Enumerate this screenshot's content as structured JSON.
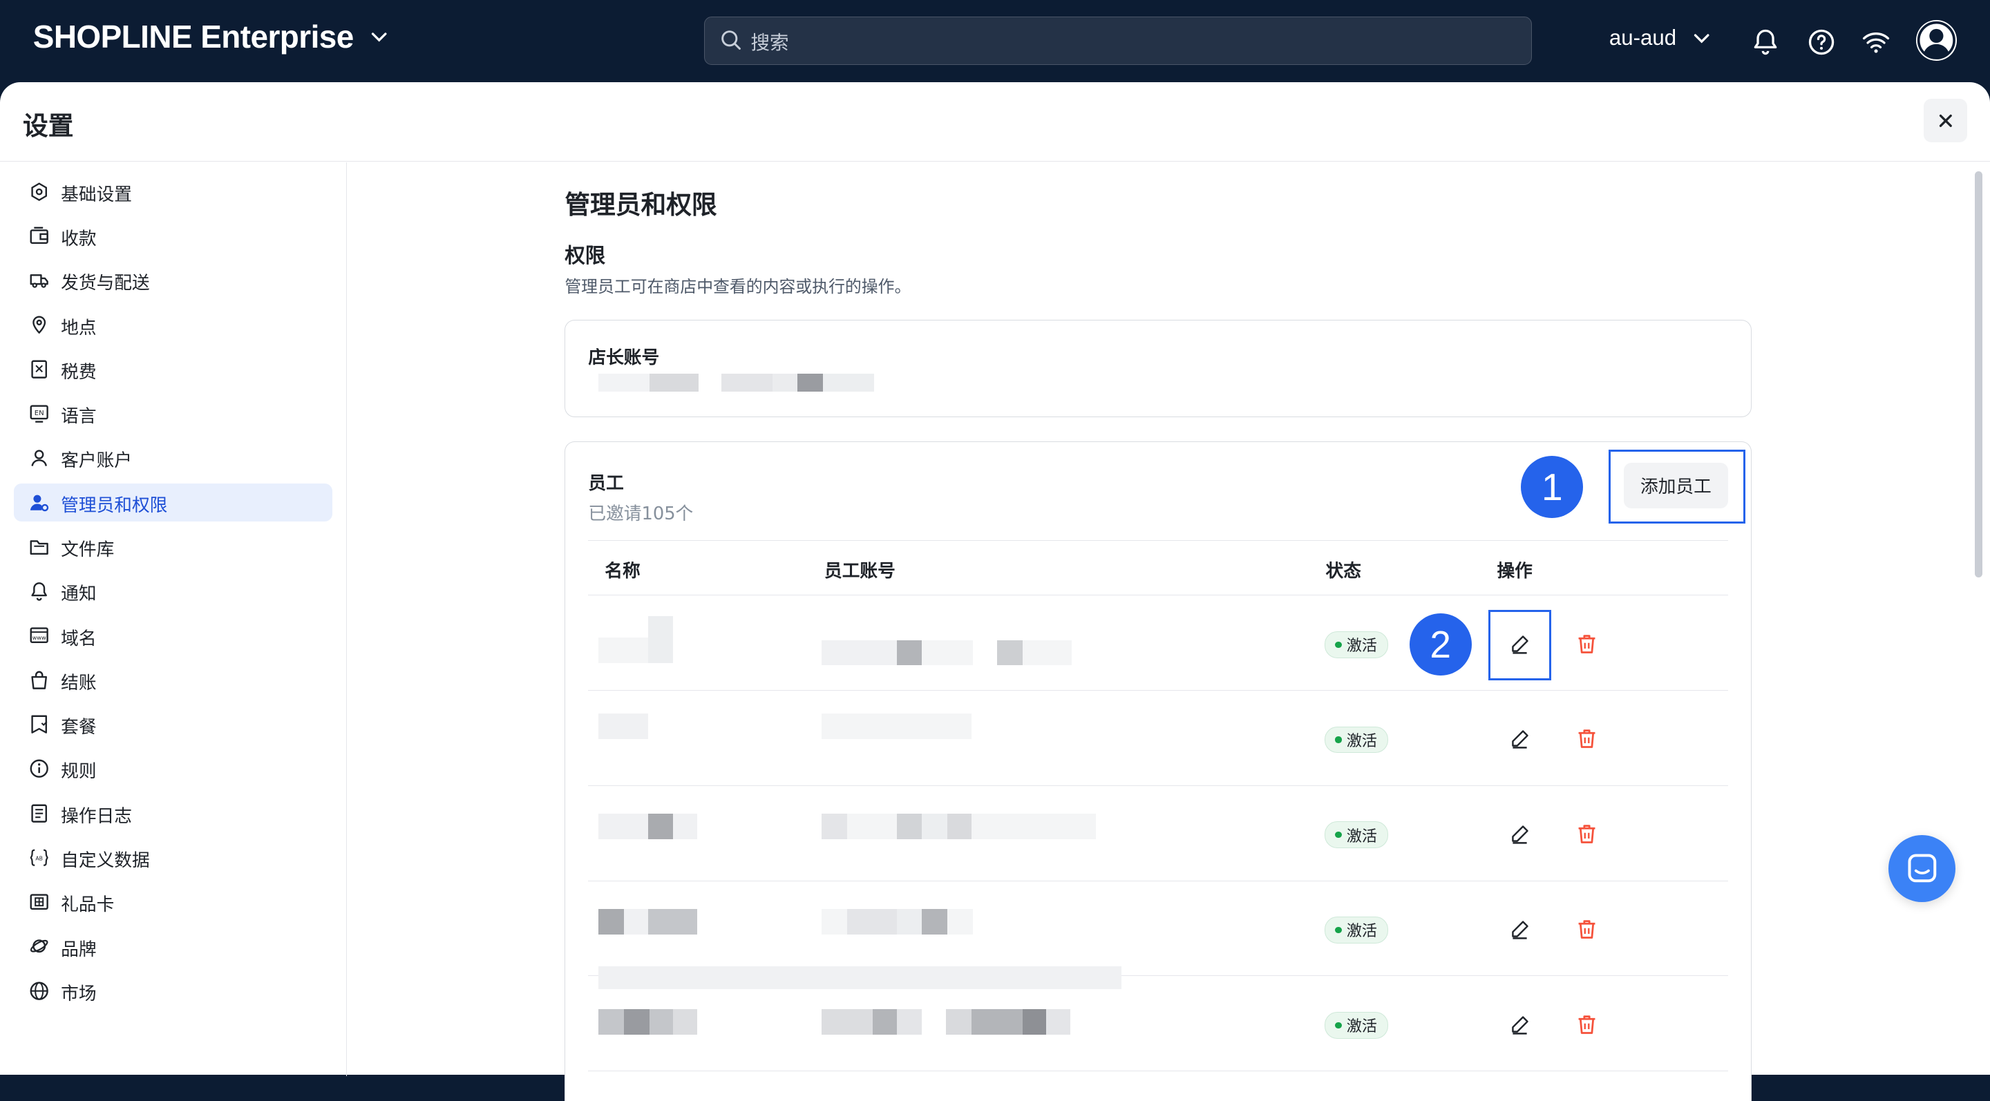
{
  "app": {
    "brand": "SHOPLINE Enterprise",
    "search_placeholder": "搜索",
    "store_name": "au-aud"
  },
  "panel": {
    "title": "设置"
  },
  "sidebar": {
    "items": [
      {
        "label": "基础设置",
        "icon": "store-settings-icon"
      },
      {
        "label": "收款",
        "icon": "payment-icon"
      },
      {
        "label": "发货与配送",
        "icon": "truck-icon"
      },
      {
        "label": "地点",
        "icon": "location-pin-icon"
      },
      {
        "label": "税费",
        "icon": "tax-receipt-icon"
      },
      {
        "label": "语言",
        "icon": "language-icon"
      },
      {
        "label": "客户账户",
        "icon": "user-icon"
      },
      {
        "label": "管理员和权限",
        "icon": "user-settings-icon",
        "active": true
      },
      {
        "label": "文件库",
        "icon": "folder-icon"
      },
      {
        "label": "通知",
        "icon": "bell-icon"
      },
      {
        "label": "域名",
        "icon": "domain-icon"
      },
      {
        "label": "结账",
        "icon": "shopping-bag-icon"
      },
      {
        "label": "套餐",
        "icon": "plan-icon"
      },
      {
        "label": "规则",
        "icon": "info-icon"
      },
      {
        "label": "操作日志",
        "icon": "log-icon"
      },
      {
        "label": "自定义数据",
        "icon": "custom-data-icon"
      },
      {
        "label": "礼品卡",
        "icon": "gift-card-icon"
      },
      {
        "label": "品牌",
        "icon": "planet-icon"
      },
      {
        "label": "市场",
        "icon": "globe-icon"
      }
    ]
  },
  "content": {
    "title": "管理员和权限",
    "section_title": "权限",
    "section_desc": "管理员工可在商店中查看的内容或执行的操作。",
    "owner_label": "店长账号",
    "staff_label": "员工",
    "staff_count": "已邀请105个",
    "add_staff_label": "添加员工",
    "badge1": "1",
    "badge2": "2",
    "columns": [
      "名称",
      "员工账号",
      "状态",
      "操作"
    ],
    "rows": [
      {
        "status": "激活"
      },
      {
        "status": "激活"
      },
      {
        "status": "激活"
      },
      {
        "status": "激活"
      },
      {
        "status": "激活"
      }
    ]
  },
  "colors": {
    "topbar": "#0c1c33",
    "accent": "#2563eb",
    "active_nav_bg": "#e8effd",
    "delete": "#f5523b",
    "status_dot": "#16a34a"
  }
}
